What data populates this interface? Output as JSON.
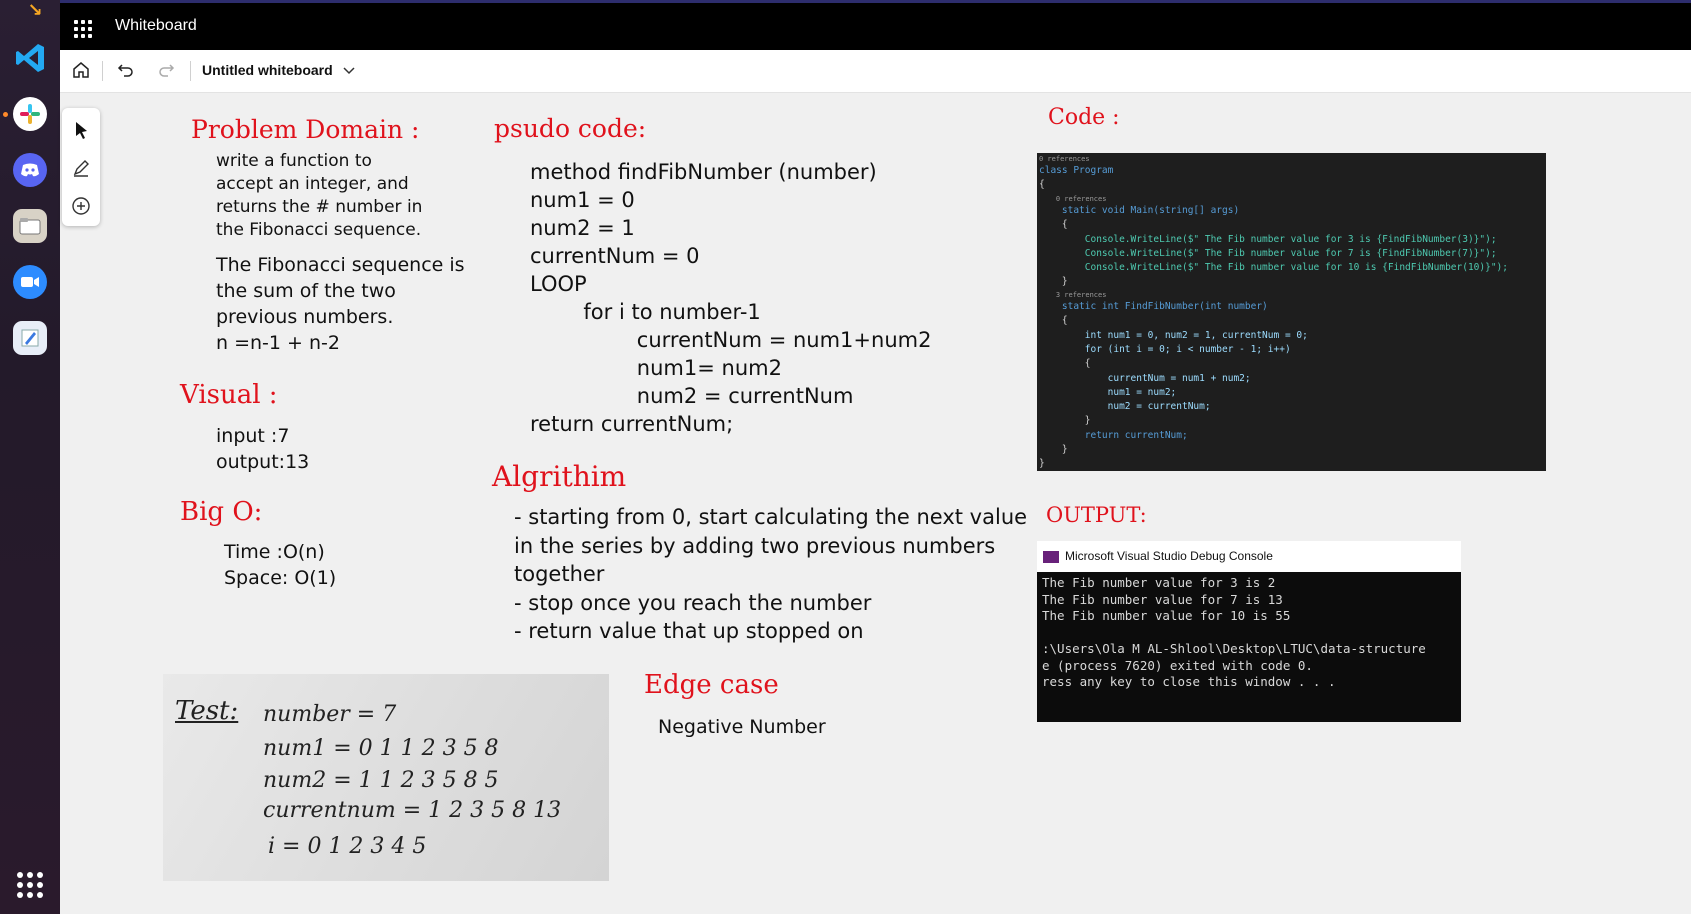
{
  "app": {
    "title": "Whiteboard"
  },
  "toolbar": {
    "doc_title": "Untitled whiteboard"
  },
  "dock": {
    "apps": [
      "vscode-icon",
      "slack-icon",
      "discord-icon",
      "files-icon",
      "zoom-icon",
      "text-editor-icon"
    ]
  },
  "board": {
    "problem_domain": {
      "title": "Problem Domain :",
      "text1": "write a function to\naccept an integer, and\nreturns the # number in\nthe Fibonacci sequence.",
      "text2": "The Fibonacci sequence is\nthe sum of the two\nprevious numbers.\nn =n-1 + n-2"
    },
    "visual": {
      "title": "Visual :",
      "text": "input :7\noutput:13"
    },
    "big_o": {
      "title": "Big O:",
      "text": "Time :O(n)\nSpace: O(1)"
    },
    "psudo": {
      "title": "psudo code:",
      "lines": [
        "method findFibNumber (number)",
        "num1 = 0",
        "num2 = 1",
        "currentNum = 0",
        "LOOP",
        "        for i to number-1",
        "                currentNum = num1+num2",
        "                num1= num2",
        "                num2 = currentNum",
        "return currentNum;"
      ]
    },
    "algorithm": {
      "title": "Algrithim",
      "lines": [
        "- starting from 0, start calculating the next value",
        "in the series by adding two previous numbers",
        "together",
        "- stop once you reach the number",
        "- return value that up stopped on"
      ]
    },
    "edge_case": {
      "title": "Edge case",
      "text": "Negative Number"
    },
    "code": {
      "title": "Code :"
    },
    "output": {
      "title": "OUTPUT:"
    },
    "test_photo": {
      "label": "Test:",
      "lines": [
        "number = 7",
        "num1 = 0 1 1 2 3 5 8",
        "num2 = 1 1 2 3 5 8 5",
        "currentnum = 1 2 3 5 8 13",
        "i = 0 1 2 3 4 5"
      ]
    }
  },
  "code_screenshot": {
    "lines": [
      "0 references",
      "class Program",
      "{",
      "    0 references",
      "    static void Main(string[] args)",
      "    {",
      "        Console.WriteLine($\" The Fib number value for 3 is {FindFibNumber(3)}\");",
      "        Console.WriteLine($\" The Fib number value for 7 is {FindFibNumber(7)}\");",
      "        Console.WriteLine($\" The Fib number value for 10 is {FindFibNumber(10)}\");",
      "    }",
      "    3 references",
      "    static int FindFibNumber(int number)",
      "    {",
      "        int num1 = 0, num2 = 1, currentNum = 0;",
      "        for (int i = 0; i < number - 1; i++)",
      "        {",
      "            currentNum = num1 + num2;",
      "            num1 = num2;",
      "            num2 = currentNum;",
      "        }",
      "        return currentNum;",
      "    }",
      "}"
    ]
  },
  "console": {
    "title": "Microsoft Visual Studio Debug Console",
    "lines": [
      "The Fib number value for 3 is 2",
      "The Fib number value for 7 is 13",
      "The Fib number value for 10 is 55",
      "",
      ":\\Users\\Ola M AL-Shlool\\Desktop\\LTUC\\data-structure",
      "e (process 7620) exited with code 0.",
      "ress any key to close this window . . ."
    ]
  },
  "colors": {
    "accent_red": "#e0121c",
    "titlebar": "#000000",
    "dock": "#2a1f33"
  }
}
